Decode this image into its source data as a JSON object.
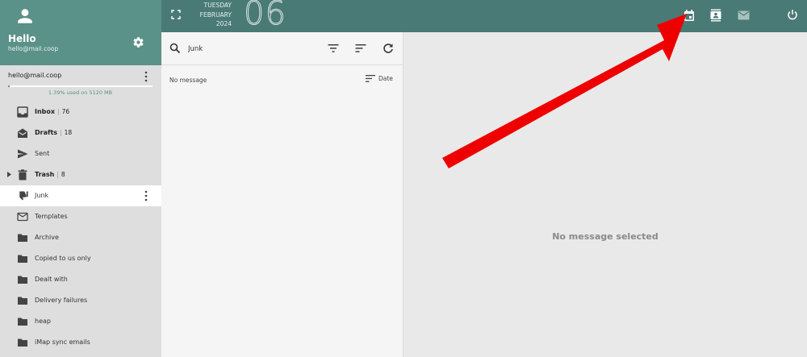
{
  "account": {
    "greeting": "Hello",
    "email": "hello@mail.coop",
    "account_label": "hello@mail.coop",
    "quota_text": "1.39% used on 5120 MB",
    "quota_fraction": 0.0139
  },
  "date": {
    "weekday": "TUESDAY",
    "month": "FEBRUARY",
    "year": "2024",
    "day": "06"
  },
  "folders": [
    {
      "label": "Inbox",
      "count": "76",
      "bold": true,
      "icon": "inbox-icon"
    },
    {
      "label": "Drafts",
      "count": "18",
      "bold": true,
      "icon": "drafts-icon"
    },
    {
      "label": "Sent",
      "count": "",
      "bold": false,
      "icon": "send-icon"
    },
    {
      "label": "Trash",
      "count": "8",
      "bold": true,
      "icon": "trash-icon",
      "expandable": true
    },
    {
      "label": "Junk",
      "count": "",
      "bold": false,
      "icon": "thumbs-down-icon",
      "active": true
    },
    {
      "label": "Templates",
      "count": "",
      "bold": false,
      "icon": "mail-outline-icon"
    },
    {
      "label": "Archive",
      "count": "",
      "bold": false,
      "icon": "folder-icon"
    },
    {
      "label": "Copied to us only",
      "count": "",
      "bold": false,
      "icon": "folder-icon"
    },
    {
      "label": "Dealt with",
      "count": "",
      "bold": false,
      "icon": "folder-icon"
    },
    {
      "label": "Delivery failures",
      "count": "",
      "bold": false,
      "icon": "folder-icon"
    },
    {
      "label": "heap",
      "count": "",
      "bold": false,
      "icon": "folder-icon"
    },
    {
      "label": "iMap sync emails",
      "count": "",
      "bold": false,
      "icon": "folder-icon"
    }
  ],
  "message_list": {
    "search_value": "Junk",
    "empty_text": "No message",
    "sort_label": "Date"
  },
  "reader": {
    "empty_text": "No message selected"
  },
  "colors": {
    "header": "#5a9188",
    "topbar": "#497a76",
    "annotation_arrow": "#ff0000"
  }
}
